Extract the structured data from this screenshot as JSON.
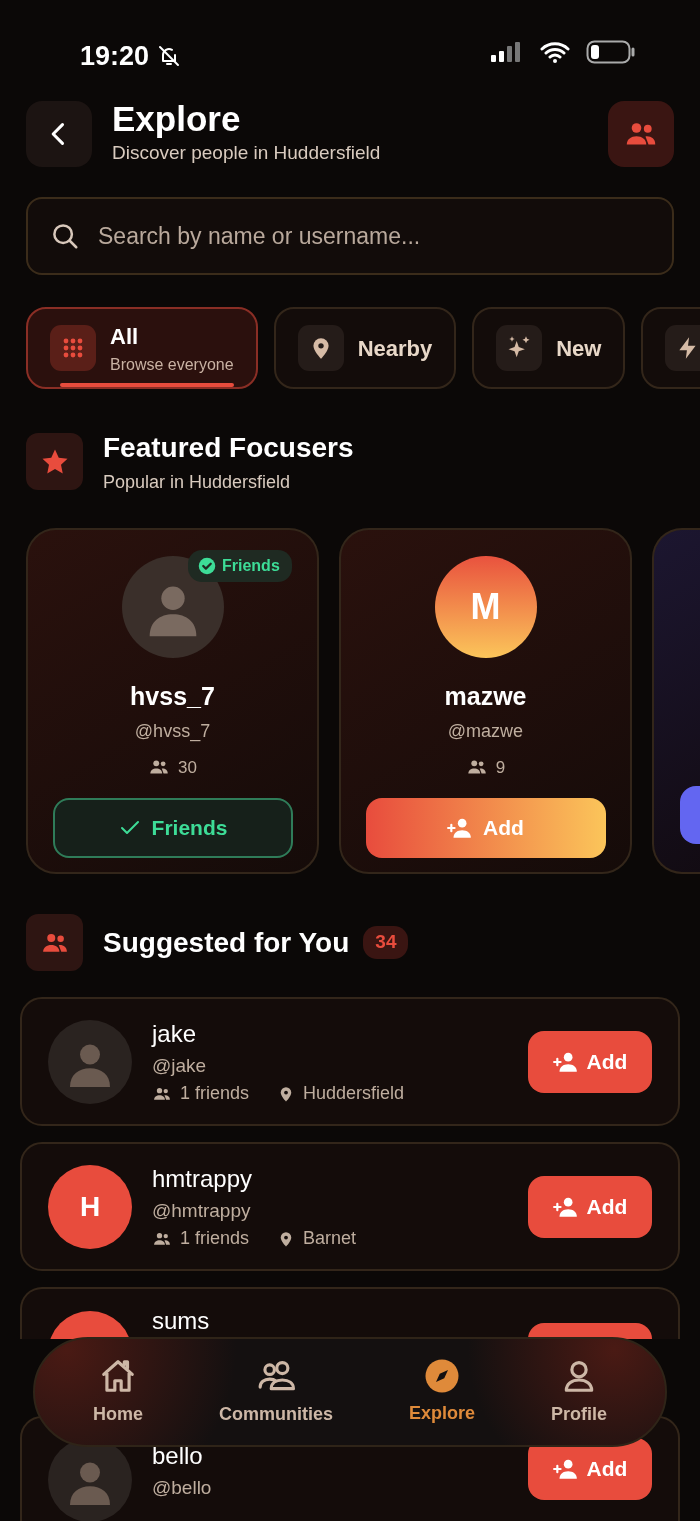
{
  "status_bar": {
    "time": "19:20",
    "silent": true
  },
  "header": {
    "title": "Explore",
    "subtitle": "Discover people in Huddersfield"
  },
  "search": {
    "placeholder": "Search by name or username..."
  },
  "filters": [
    {
      "label": "All",
      "subtitle": "Browse everyone",
      "selected": true
    },
    {
      "label": "Nearby",
      "selected": false
    },
    {
      "label": "New",
      "selected": false
    },
    {
      "selected": false
    }
  ],
  "featured": {
    "title": "Featured Focusers",
    "subtitle": "Popular in Huddersfield",
    "cards": [
      {
        "kind": "photo",
        "name": "hvss_7",
        "handle": "@hvss_7",
        "friends_count": "30",
        "is_friend": true,
        "badge": "Friends",
        "action": "Friends"
      },
      {
        "kind": "initial",
        "letter": "M",
        "name": "mazwe",
        "handle": "@mazwe",
        "friends_count": "9",
        "is_friend": false,
        "action": "Add"
      },
      {
        "kind": "partial"
      }
    ]
  },
  "suggested": {
    "title": "Suggested for You",
    "count": "34",
    "people": [
      {
        "kind": "photo",
        "name": "jake",
        "handle": "@jake",
        "friends": "1 friends",
        "location": "Huddersfield",
        "action": "Add"
      },
      {
        "kind": "initial",
        "letter": "H",
        "name": "hmtrappy",
        "handle": "@hmtrappy",
        "friends": "1 friends",
        "location": "Barnet",
        "action": "Add"
      },
      {
        "kind": "initial",
        "name": "sums"
      },
      {
        "kind": "photo",
        "name": "bello",
        "handle": "@bello",
        "action": "Add"
      }
    ]
  },
  "tab_bar": [
    {
      "label": "Home",
      "selected": false
    },
    {
      "label": "Communities",
      "selected": false
    },
    {
      "label": "Explore",
      "selected": true
    },
    {
      "label": "Profile",
      "selected": false
    }
  ]
}
